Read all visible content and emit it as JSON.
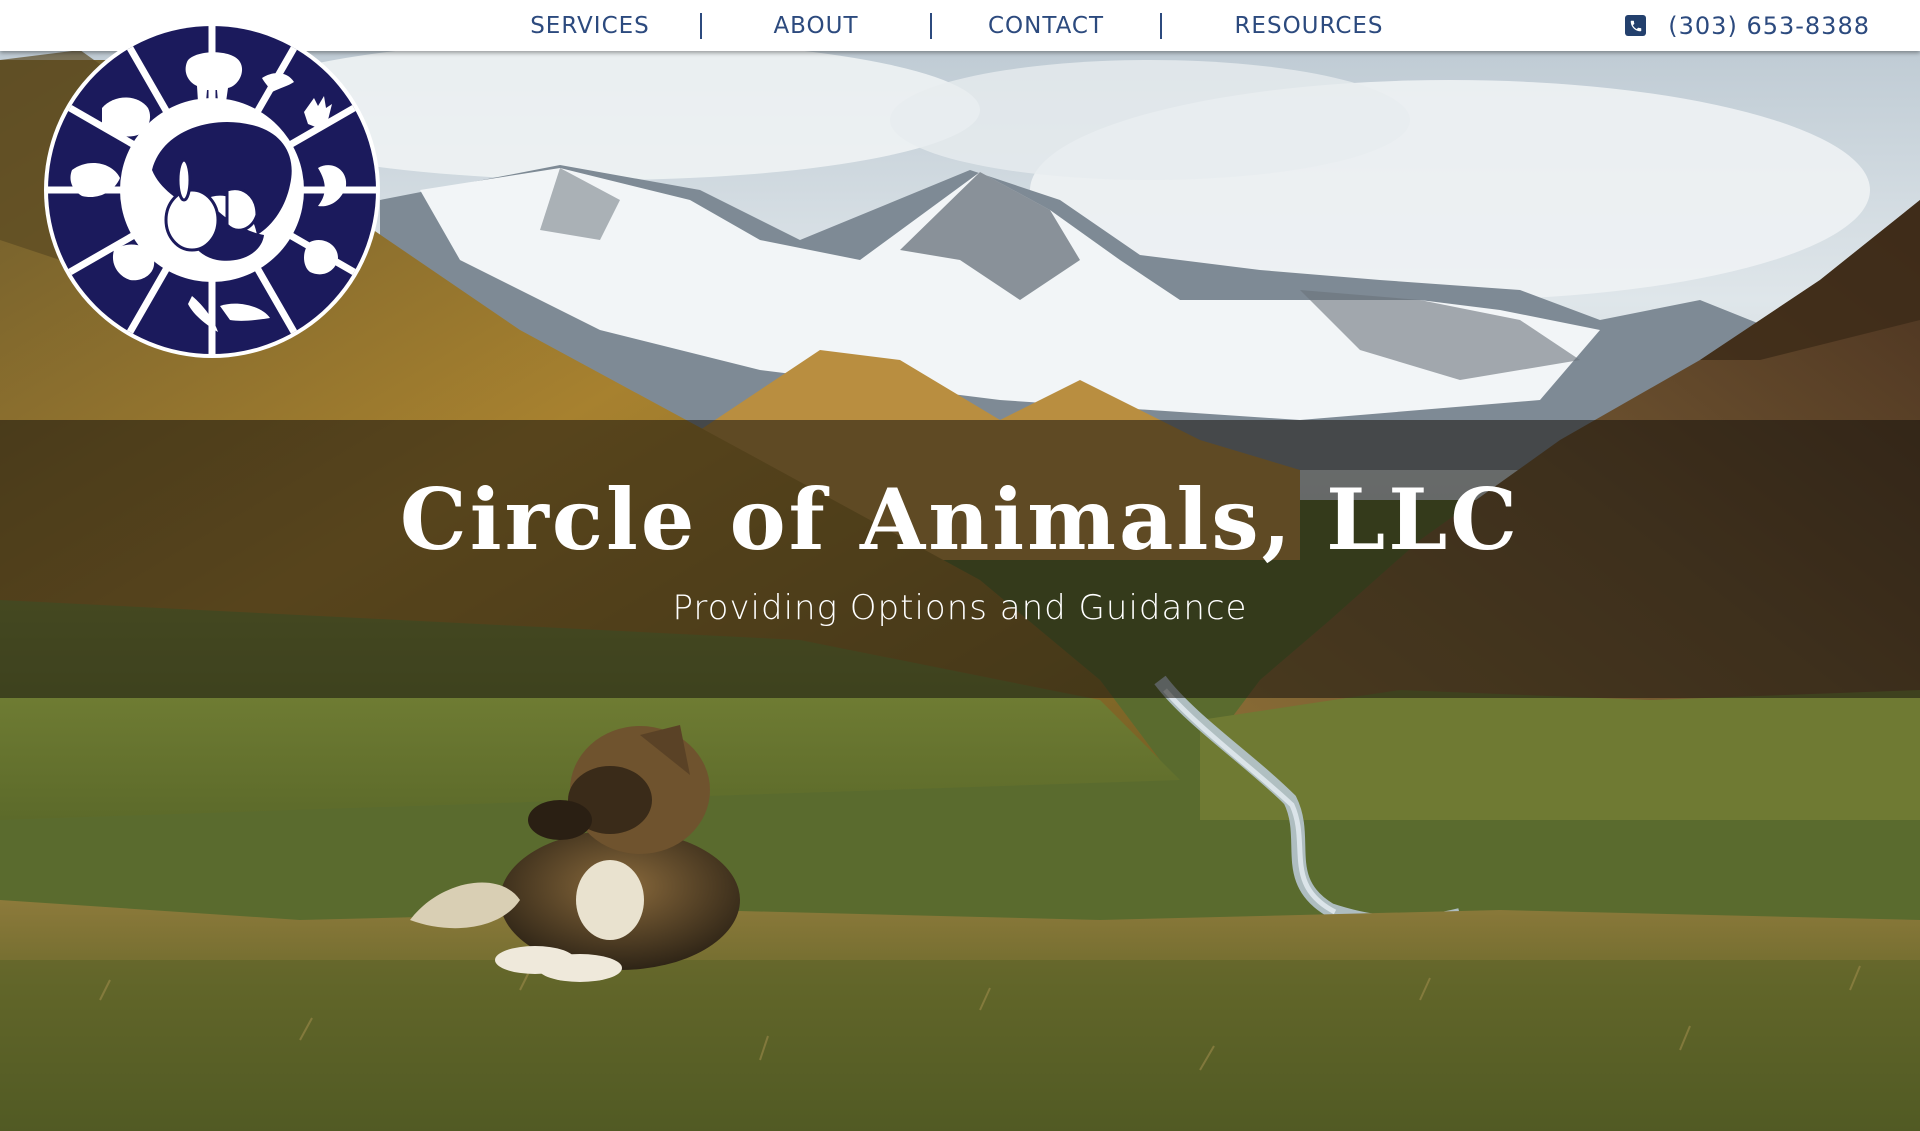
{
  "nav": {
    "items": [
      {
        "label": "SERVICES"
      },
      {
        "label": "ABOUT"
      },
      {
        "label": "CONTACT"
      },
      {
        "label": "RESOURCES"
      }
    ]
  },
  "contact": {
    "phone": "(303) 653-8388",
    "icon": "phone-icon"
  },
  "hero": {
    "title": "Circle of Animals, LLC",
    "subtitle": "Providing Options and Guidance"
  },
  "colors": {
    "brand_navy": "#1b1a5c",
    "nav_text": "#2c4a7e",
    "header_bg": "#ffffff",
    "band_overlay": "rgba(22,18,12,0.55)"
  }
}
